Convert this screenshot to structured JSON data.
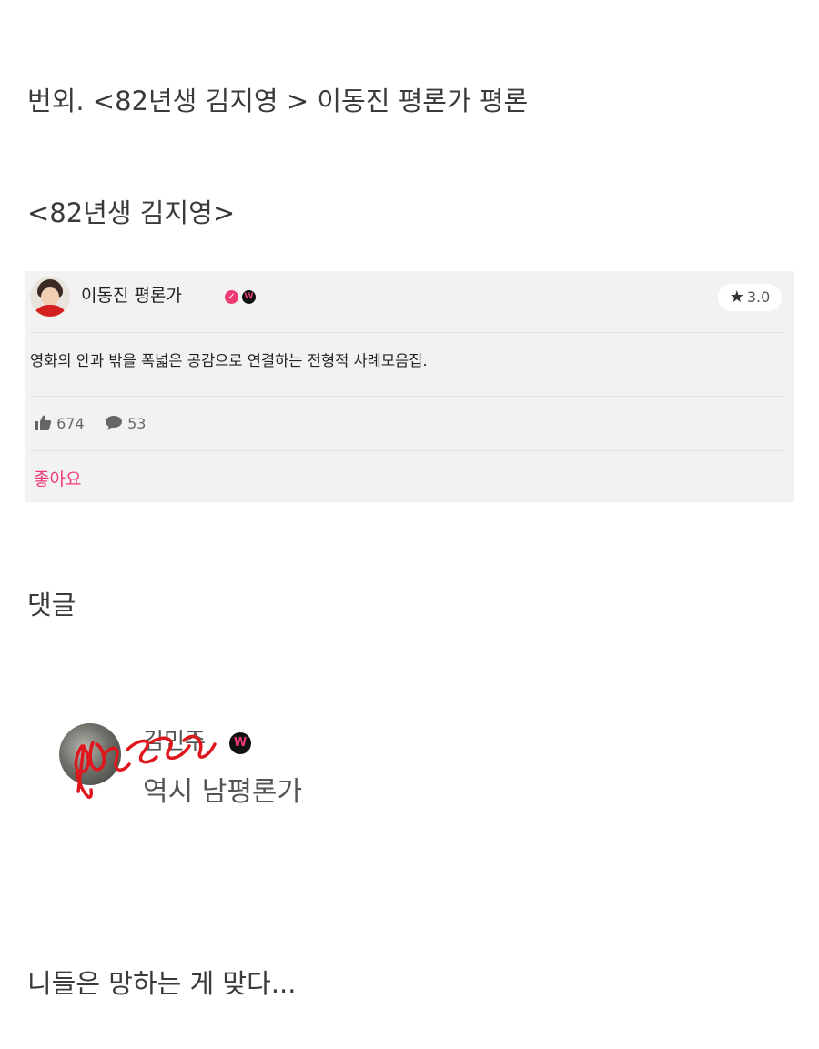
{
  "post": {
    "title_line": "번외. <82년생 김지영 > 이동진 평론가 평론",
    "movie_heading": "<82년생 김지영>",
    "comments_heading": "댓글",
    "closing_remark": "니들은 망하는 게 맞다..."
  },
  "review_card": {
    "author_name": "이동진 평론가",
    "verified_mark": "✓",
    "w_badge_label": "W",
    "rating_icon": "star-icon",
    "rating_value": "3.0",
    "review_text": "영화의 안과 밖을 폭넓은 공감으로 연결하는 전형적 사례모음집.",
    "likes_icon": "thumbs-up-icon",
    "likes_count": "674",
    "comments_icon": "speech-bubble-icon",
    "comments_count": "53",
    "like_button_label": "좋아요",
    "accent_color": "#ef3b73",
    "card_background": "#f2f2f2"
  },
  "comment": {
    "user_name": "김민주",
    "w_badge_label": "W",
    "text": "역시 남평론가",
    "name_obscured_by": "red scribble"
  }
}
